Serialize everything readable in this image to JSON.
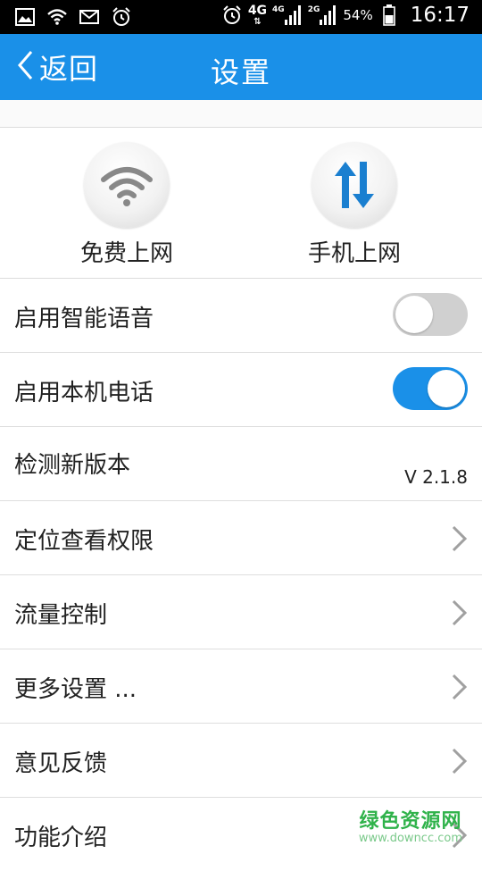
{
  "status_bar": {
    "signal_4g_label": "4G",
    "signal_sim1_label": "4G",
    "signal_sim2_label": "2G",
    "battery_percent": "54%",
    "time": "16:17"
  },
  "header": {
    "back_label": "返回",
    "title": "设置"
  },
  "shortcuts": [
    {
      "label": "免费上网",
      "icon": "wifi-icon"
    },
    {
      "label": "手机上网",
      "icon": "data-transfer-icon"
    }
  ],
  "settings": {
    "smart_voice": {
      "label": "启用智能语音",
      "enabled": false
    },
    "local_call": {
      "label": "启用本机电话",
      "enabled": true
    },
    "check_update": {
      "label": "检测新版本",
      "version": "V 2.1.8"
    },
    "location_permission": {
      "label": "定位查看权限"
    },
    "traffic_control": {
      "label": "流量控制"
    },
    "more_settings": {
      "label": "更多设置 ..."
    },
    "feedback": {
      "label": "意见反馈"
    },
    "features": {
      "label": "功能介绍"
    }
  },
  "watermark": {
    "title": "绿色资源网",
    "url": "www.downcc.com"
  },
  "colors": {
    "accent": "#1a90e8",
    "toggle_off": "#d0d0d0",
    "watermark": "#2fb24a"
  }
}
